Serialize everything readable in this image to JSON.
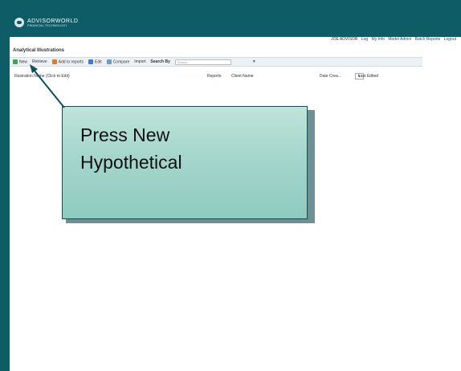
{
  "header": {
    "logo_text": "ADVISORWORLD",
    "logo_subtext": "FINANCIAL TECHNOLOGY"
  },
  "userbar": {
    "user": "JOE ADVISOR",
    "links": [
      "Log",
      "My Info",
      "Model Admin",
      "Batch Reports",
      "Logout"
    ]
  },
  "page": {
    "title": "Analytical Illustrations"
  },
  "toolbar": {
    "items": [
      "New",
      "Retrieve",
      "Add to reports",
      "Edit",
      "Compare",
      "Import"
    ],
    "search_label": "Search By",
    "search_placeholder": "Search",
    "icon_colors": [
      "#3aa655",
      "#999999",
      "#e07b25",
      "#3b7bd1",
      "#6b9bd6",
      "#aaaaaa"
    ]
  },
  "columns": {
    "name": "Illustration Name (Click to Edit)",
    "reports": "Reports",
    "client": "Client Name",
    "date": "Date Crea...",
    "date_filter": "Last Edited"
  },
  "callout": {
    "line1": "Press New",
    "line2": "Hypothetical"
  }
}
